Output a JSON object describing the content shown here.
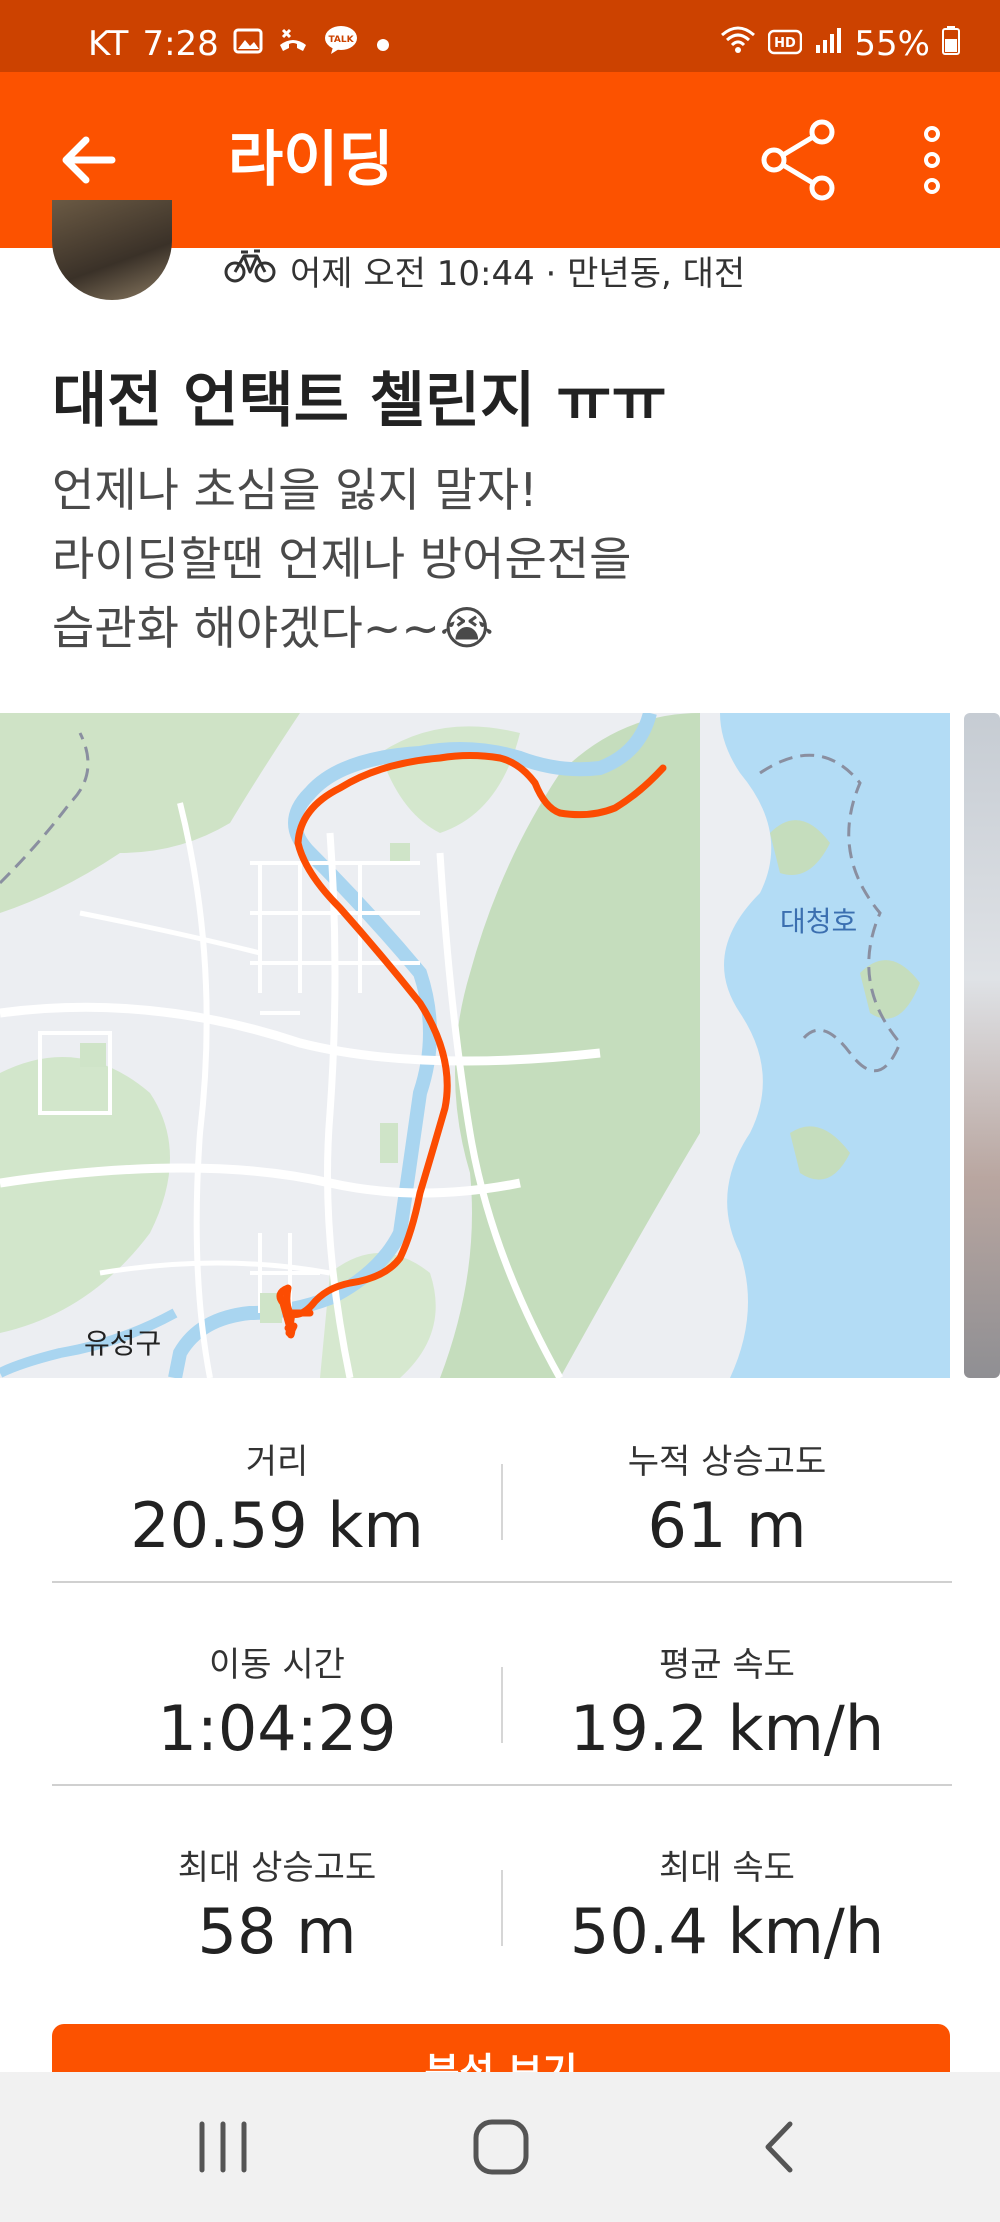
{
  "status_bar": {
    "carrier": "KT",
    "time": "7:28",
    "battery": "55%",
    "icons": [
      "gallery-icon",
      "missed-call-icon",
      "kakaotalk-icon",
      "dot-icon",
      "wifi-icon",
      "hd-icon",
      "signal-icon",
      "battery-icon"
    ]
  },
  "app_bar": {
    "title": "라이딩",
    "back_icon": "back-arrow-icon",
    "share_icon": "share-icon",
    "more_icon": "more-vertical-icon"
  },
  "post": {
    "meta": "어제 오전 10:44 · 만년동, 대전",
    "meta_icon": "bicycle-icon",
    "title": "대전 언택트 첼린지 ㅠㅠ",
    "description": "언제나 초심을 잃지 말자!\n라이딩할땐 언제나 방어운전을\n습관화 해야겠다~~😭"
  },
  "map": {
    "labels": [
      "대청호",
      "유성구"
    ],
    "route_color": "#fc4c02"
  },
  "stats": [
    {
      "left": {
        "label": "거리",
        "value": "20.59 km"
      },
      "right": {
        "label": "누적 상승고도",
        "value": "61 m"
      }
    },
    {
      "left": {
        "label": "이동 시간",
        "value": "1:04:29"
      },
      "right": {
        "label": "평균 속도",
        "value": "19.2 km/h"
      }
    },
    {
      "left": {
        "label": "최대 상승고도",
        "value": "58 m"
      },
      "right": {
        "label": "최대 속도",
        "value": "50.4 km/h"
      }
    }
  ],
  "analyze_button": {
    "label": "분석 보기"
  },
  "nav": {
    "icons": [
      "recent-apps-icon",
      "home-icon",
      "back-icon"
    ]
  },
  "colors": {
    "accent": "#fc5200",
    "status_bar": "#cc4200",
    "water": "#b3dcf5",
    "park": "#cfe4c8"
  }
}
